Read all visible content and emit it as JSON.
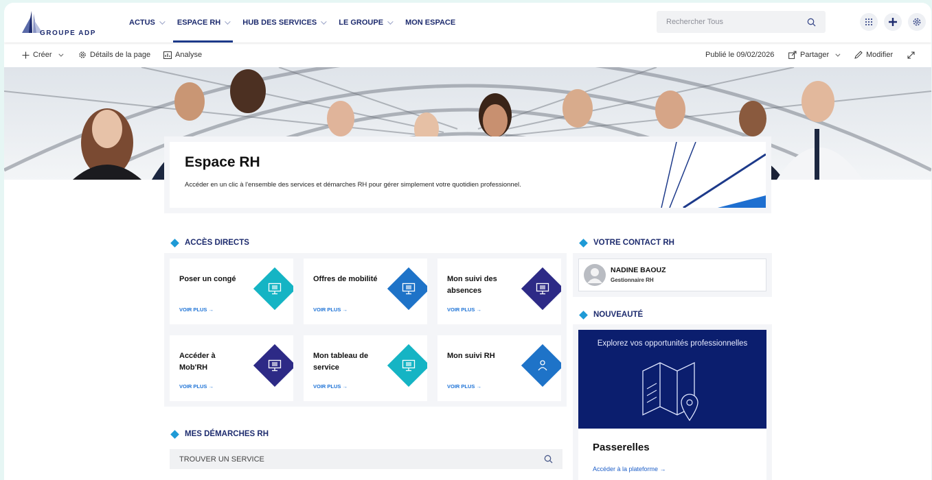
{
  "brand": {
    "name": "GROUPE ADP"
  },
  "nav": [
    {
      "label": "ACTUS",
      "has_menu": true
    },
    {
      "label": "ESPACE RH",
      "has_menu": true,
      "active": true
    },
    {
      "label": "HUB DES SERVICES",
      "has_menu": true
    },
    {
      "label": "LE GROUPE",
      "has_menu": true
    },
    {
      "label": "MON ESPACE",
      "has_menu": false
    }
  ],
  "search": {
    "placeholder": "Rechercher Tous"
  },
  "header_icons": [
    "app-launcher-icon",
    "add-icon",
    "settings-icon"
  ],
  "commands": {
    "create": "Créer",
    "page_details": "Détails de la page",
    "analytics": "Analyse",
    "published": "Publié le 09/02/2026",
    "share": "Partager",
    "edit": "Modifier"
  },
  "hero": {
    "title": "Espace RH",
    "subtitle": "Accéder en un clic à l'ensemble des services et démarches RH pour gérer simplement votre quotidien professionnel."
  },
  "acces_directs": {
    "heading": "ACCÈS DIRECTS",
    "tiles": [
      {
        "label": "Poser un congé",
        "link": "VOIR PLUS →",
        "color": "#15b4c4",
        "icon": "computer-icon"
      },
      {
        "label": "Offres de mobilité",
        "link": "VOIR PLUS →",
        "color": "#1e73c8",
        "icon": "computer-icon"
      },
      {
        "label": "Mon suivi des absences",
        "link": "VOIR PLUS →",
        "color": "#2d2a86",
        "icon": "computer-icon"
      },
      {
        "label": "Accéder à Mob'RH",
        "link": "VOIR PLUS →",
        "color": "#2d2a86",
        "icon": "computer-icon"
      },
      {
        "label": "Mon tableau de service",
        "link": "VOIR PLUS →",
        "color": "#15b4c4",
        "icon": "computer-icon"
      },
      {
        "label": "Mon suivi RH",
        "link": "VOIR PLUS →",
        "color": "#1e73c8",
        "icon": "person-icon"
      }
    ]
  },
  "contact_rh": {
    "heading": "VOTRE CONTACT RH",
    "name": "NADINE BAOUZ",
    "role": "Gestionnaire RH"
  },
  "nouveaute": {
    "heading": "NOUVEAUTÉ",
    "banner": "Explorez vos opportunités professionnelles",
    "title": "Passerelles",
    "link": "Accéder à la plateforme →"
  },
  "demarches": {
    "heading": "MES DÉMARCHES RH",
    "search_label": "TROUVER UN SERVICE"
  },
  "colors": {
    "primary": "#1d2b6e",
    "accent": "#1e9ad6",
    "navy": "#0b1e6e",
    "link": "#1e73d6"
  }
}
